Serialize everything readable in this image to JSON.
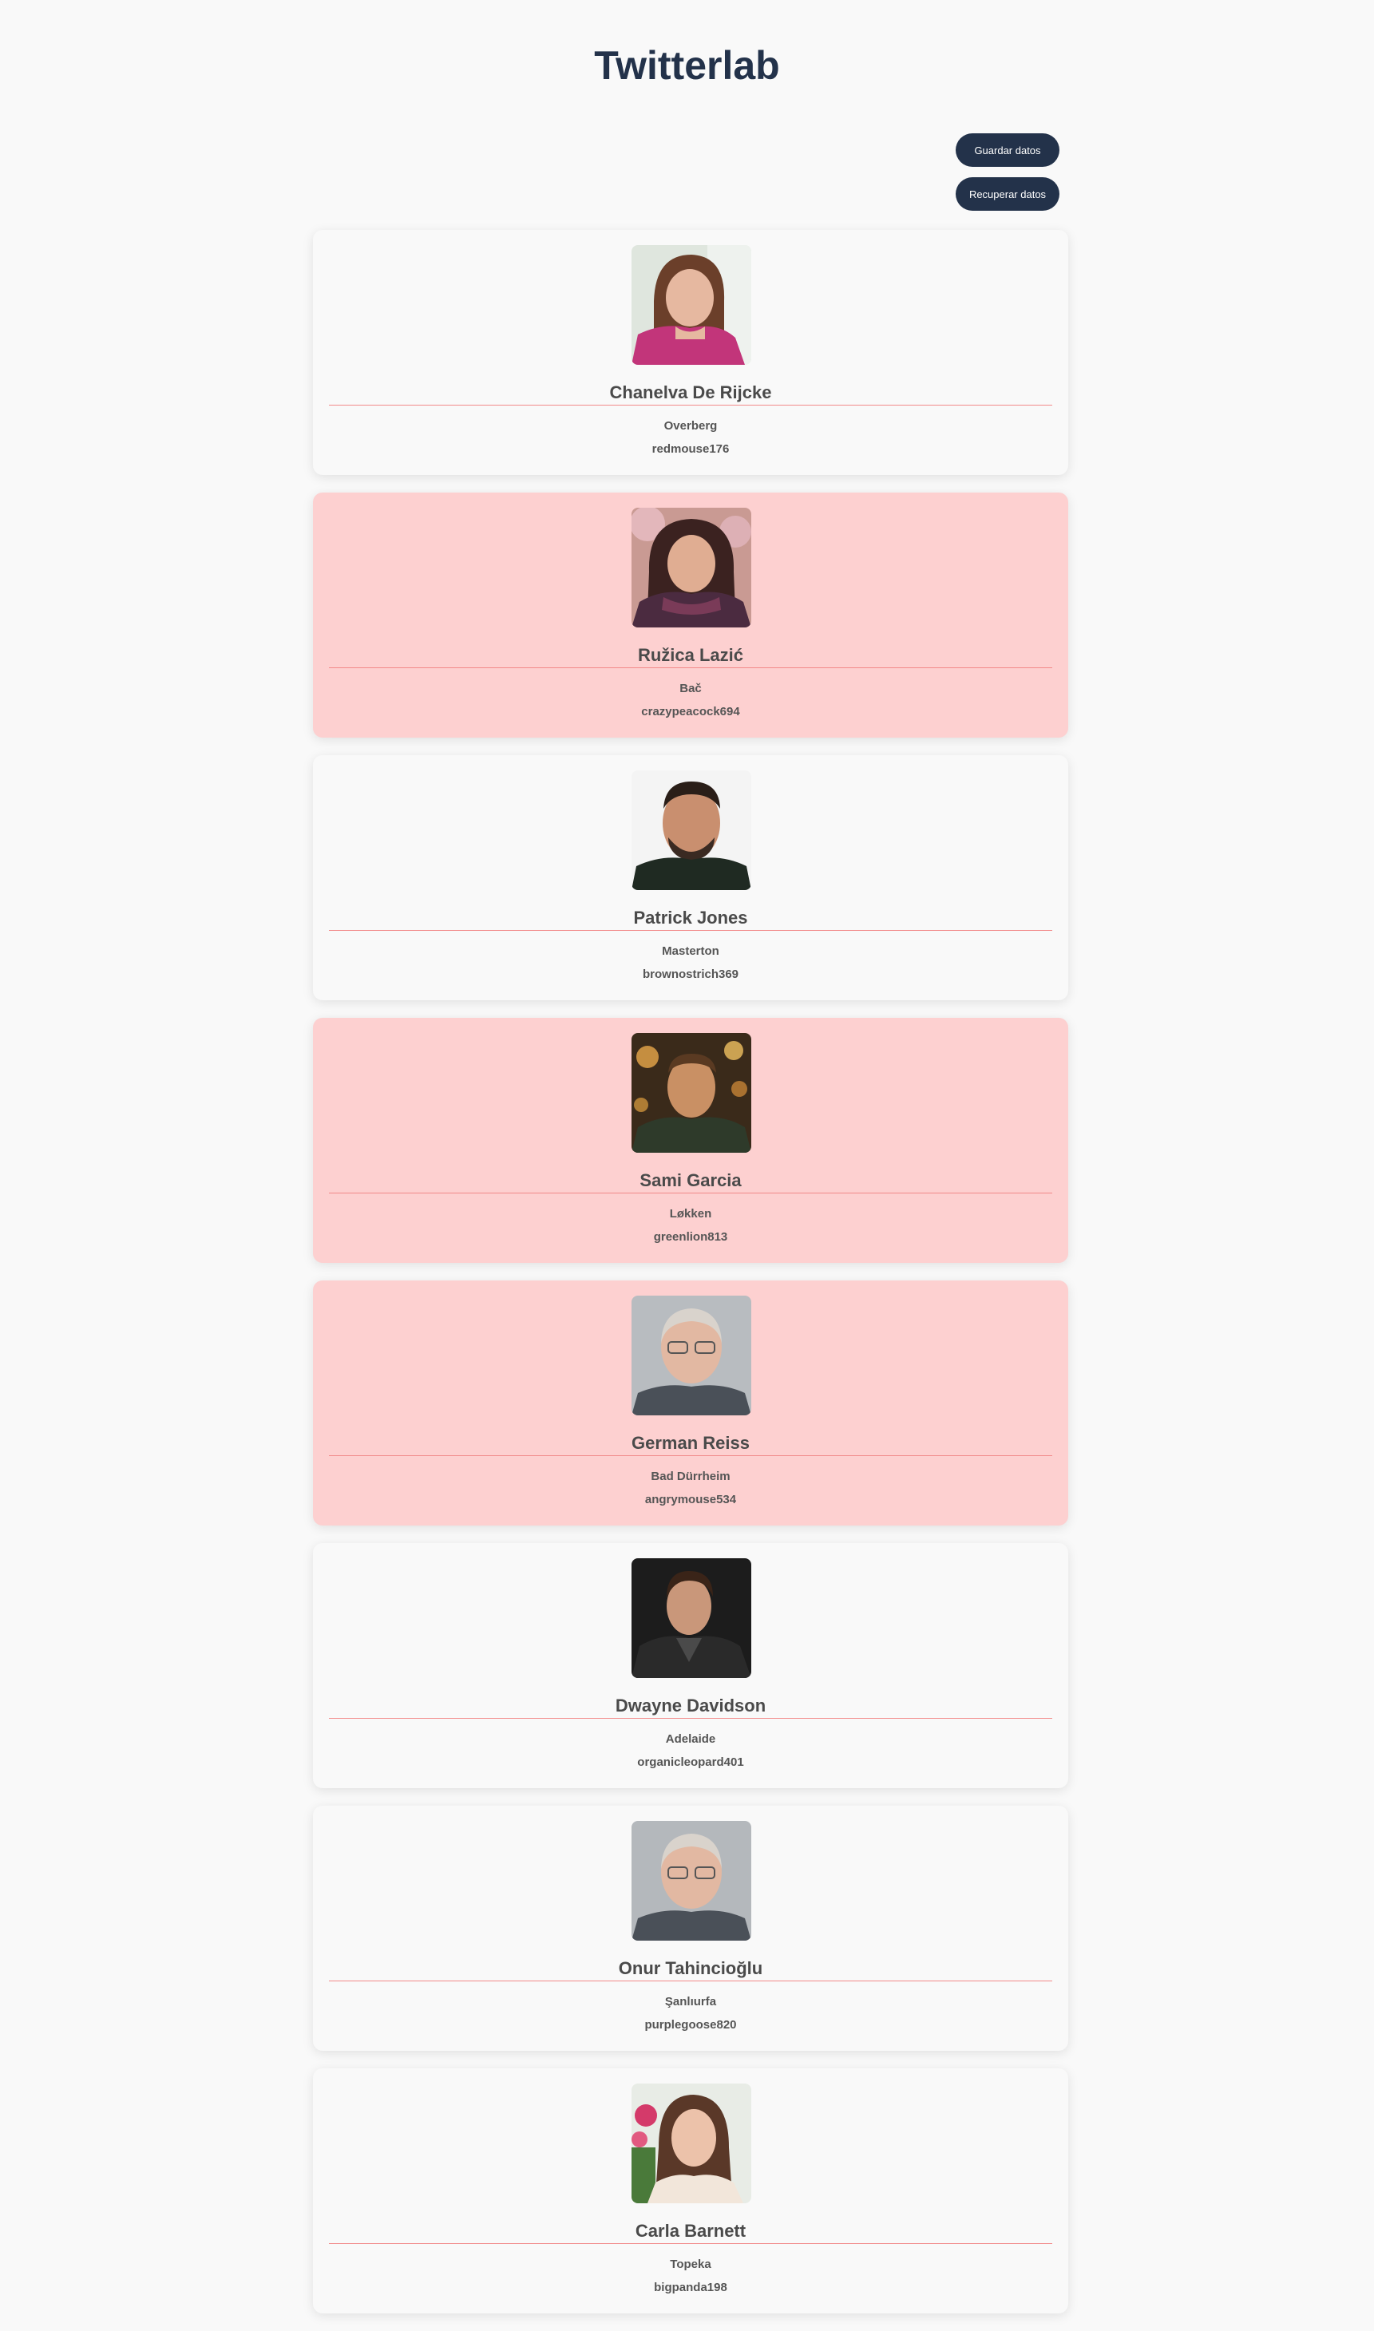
{
  "header": {
    "title": "Twitterlab"
  },
  "actions": {
    "save_label": "Guardar datos",
    "load_label": "Recuperar datos"
  },
  "colors": {
    "title": "#23324a",
    "button_bg": "#23324a",
    "highlight_bg": "#fdd0d0",
    "divider": "#f28a8a"
  },
  "users": [
    {
      "name": "Chanelva De Rijcke",
      "city": "Overberg",
      "username": "redmouse176",
      "highlighted": false,
      "avatar_icon": "woman-portrait-photo"
    },
    {
      "name": "Ružica Lazić",
      "city": "Bač",
      "username": "crazypeacock694",
      "highlighted": true,
      "avatar_icon": "woman-portrait-photo"
    },
    {
      "name": "Patrick Jones",
      "city": "Masterton",
      "username": "brownostrich369",
      "highlighted": false,
      "avatar_icon": "man-portrait-photo"
    },
    {
      "name": "Sami Garcia",
      "city": "Løkken",
      "username": "greenlion813",
      "highlighted": true,
      "avatar_icon": "man-portrait-photo"
    },
    {
      "name": "German Reiss",
      "city": "Bad Dürrheim",
      "username": "angrymouse534",
      "highlighted": true,
      "avatar_icon": "man-portrait-photo"
    },
    {
      "name": "Dwayne Davidson",
      "city": "Adelaide",
      "username": "organicleopard401",
      "highlighted": false,
      "avatar_icon": "man-portrait-photo"
    },
    {
      "name": "Onur Tahincioğlu",
      "city": "Şanlıurfa",
      "username": "purplegoose820",
      "highlighted": false,
      "avatar_icon": "man-portrait-photo"
    },
    {
      "name": "Carla Barnett",
      "city": "Topeka",
      "username": "bigpanda198",
      "highlighted": false,
      "avatar_icon": "woman-portrait-photo"
    }
  ]
}
